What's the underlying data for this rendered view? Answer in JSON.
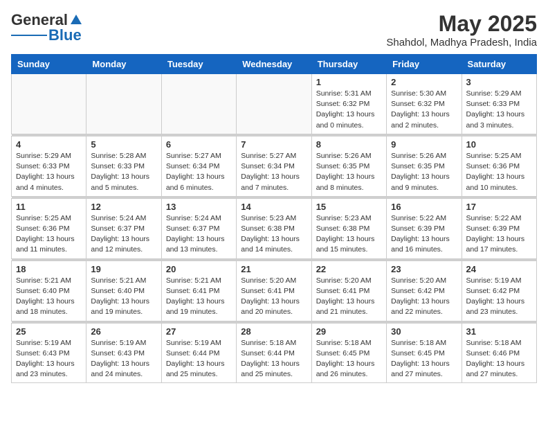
{
  "logo": {
    "general": "General",
    "blue": "Blue"
  },
  "title": "May 2025",
  "subtitle": "Shahdol, Madhya Pradesh, India",
  "days_of_week": [
    "Sunday",
    "Monday",
    "Tuesday",
    "Wednesday",
    "Thursday",
    "Friday",
    "Saturday"
  ],
  "weeks": [
    [
      {
        "day": "",
        "info": ""
      },
      {
        "day": "",
        "info": ""
      },
      {
        "day": "",
        "info": ""
      },
      {
        "day": "",
        "info": ""
      },
      {
        "day": "1",
        "info": "Sunrise: 5:31 AM\nSunset: 6:32 PM\nDaylight: 13 hours\nand 0 minutes."
      },
      {
        "day": "2",
        "info": "Sunrise: 5:30 AM\nSunset: 6:32 PM\nDaylight: 13 hours\nand 2 minutes."
      },
      {
        "day": "3",
        "info": "Sunrise: 5:29 AM\nSunset: 6:33 PM\nDaylight: 13 hours\nand 3 minutes."
      }
    ],
    [
      {
        "day": "4",
        "info": "Sunrise: 5:29 AM\nSunset: 6:33 PM\nDaylight: 13 hours\nand 4 minutes."
      },
      {
        "day": "5",
        "info": "Sunrise: 5:28 AM\nSunset: 6:33 PM\nDaylight: 13 hours\nand 5 minutes."
      },
      {
        "day": "6",
        "info": "Sunrise: 5:27 AM\nSunset: 6:34 PM\nDaylight: 13 hours\nand 6 minutes."
      },
      {
        "day": "7",
        "info": "Sunrise: 5:27 AM\nSunset: 6:34 PM\nDaylight: 13 hours\nand 7 minutes."
      },
      {
        "day": "8",
        "info": "Sunrise: 5:26 AM\nSunset: 6:35 PM\nDaylight: 13 hours\nand 8 minutes."
      },
      {
        "day": "9",
        "info": "Sunrise: 5:26 AM\nSunset: 6:35 PM\nDaylight: 13 hours\nand 9 minutes."
      },
      {
        "day": "10",
        "info": "Sunrise: 5:25 AM\nSunset: 6:36 PM\nDaylight: 13 hours\nand 10 minutes."
      }
    ],
    [
      {
        "day": "11",
        "info": "Sunrise: 5:25 AM\nSunset: 6:36 PM\nDaylight: 13 hours\nand 11 minutes."
      },
      {
        "day": "12",
        "info": "Sunrise: 5:24 AM\nSunset: 6:37 PM\nDaylight: 13 hours\nand 12 minutes."
      },
      {
        "day": "13",
        "info": "Sunrise: 5:24 AM\nSunset: 6:37 PM\nDaylight: 13 hours\nand 13 minutes."
      },
      {
        "day": "14",
        "info": "Sunrise: 5:23 AM\nSunset: 6:38 PM\nDaylight: 13 hours\nand 14 minutes."
      },
      {
        "day": "15",
        "info": "Sunrise: 5:23 AM\nSunset: 6:38 PM\nDaylight: 13 hours\nand 15 minutes."
      },
      {
        "day": "16",
        "info": "Sunrise: 5:22 AM\nSunset: 6:39 PM\nDaylight: 13 hours\nand 16 minutes."
      },
      {
        "day": "17",
        "info": "Sunrise: 5:22 AM\nSunset: 6:39 PM\nDaylight: 13 hours\nand 17 minutes."
      }
    ],
    [
      {
        "day": "18",
        "info": "Sunrise: 5:21 AM\nSunset: 6:40 PM\nDaylight: 13 hours\nand 18 minutes."
      },
      {
        "day": "19",
        "info": "Sunrise: 5:21 AM\nSunset: 6:40 PM\nDaylight: 13 hours\nand 19 minutes."
      },
      {
        "day": "20",
        "info": "Sunrise: 5:21 AM\nSunset: 6:41 PM\nDaylight: 13 hours\nand 19 minutes."
      },
      {
        "day": "21",
        "info": "Sunrise: 5:20 AM\nSunset: 6:41 PM\nDaylight: 13 hours\nand 20 minutes."
      },
      {
        "day": "22",
        "info": "Sunrise: 5:20 AM\nSunset: 6:41 PM\nDaylight: 13 hours\nand 21 minutes."
      },
      {
        "day": "23",
        "info": "Sunrise: 5:20 AM\nSunset: 6:42 PM\nDaylight: 13 hours\nand 22 minutes."
      },
      {
        "day": "24",
        "info": "Sunrise: 5:19 AM\nSunset: 6:42 PM\nDaylight: 13 hours\nand 23 minutes."
      }
    ],
    [
      {
        "day": "25",
        "info": "Sunrise: 5:19 AM\nSunset: 6:43 PM\nDaylight: 13 hours\nand 23 minutes."
      },
      {
        "day": "26",
        "info": "Sunrise: 5:19 AM\nSunset: 6:43 PM\nDaylight: 13 hours\nand 24 minutes."
      },
      {
        "day": "27",
        "info": "Sunrise: 5:19 AM\nSunset: 6:44 PM\nDaylight: 13 hours\nand 25 minutes."
      },
      {
        "day": "28",
        "info": "Sunrise: 5:18 AM\nSunset: 6:44 PM\nDaylight: 13 hours\nand 25 minutes."
      },
      {
        "day": "29",
        "info": "Sunrise: 5:18 AM\nSunset: 6:45 PM\nDaylight: 13 hours\nand 26 minutes."
      },
      {
        "day": "30",
        "info": "Sunrise: 5:18 AM\nSunset: 6:45 PM\nDaylight: 13 hours\nand 27 minutes."
      },
      {
        "day": "31",
        "info": "Sunrise: 5:18 AM\nSunset: 6:46 PM\nDaylight: 13 hours\nand 27 minutes."
      }
    ]
  ]
}
